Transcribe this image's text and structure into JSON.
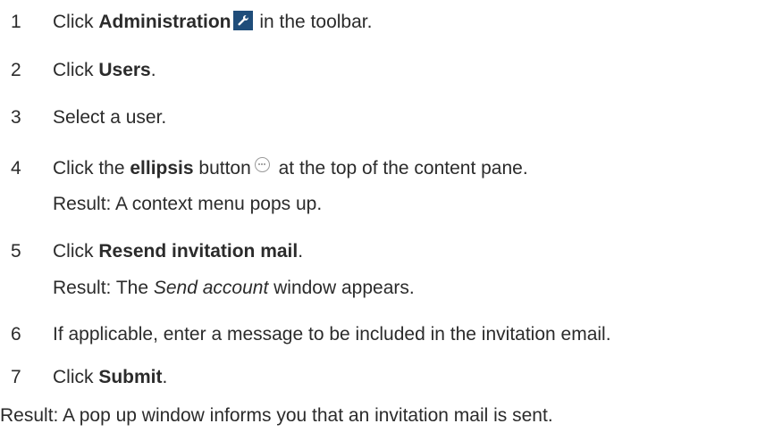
{
  "steps": [
    {
      "num": "1",
      "pre": "Click ",
      "bold": "Administration",
      "post": " in the toolbar.",
      "icon": "wrench-icon"
    },
    {
      "num": "2",
      "pre": "Click ",
      "bold": "Users",
      "post": "."
    },
    {
      "num": "3",
      "text": "Select a user."
    },
    {
      "num": "4",
      "pre": "Click the ",
      "bold": "ellipsis",
      "mid": " button",
      "post": " at the top of the content pane.",
      "icon": "ellipsis-icon",
      "result": "Result: A context menu pops up."
    },
    {
      "num": "5",
      "pre": "Click ",
      "bold": "Resend invitation mail",
      "post": ".",
      "result_pre": "Result: The ",
      "result_italic": "Send account",
      "result_post": " window appears."
    },
    {
      "num": "6",
      "text": "If applicable, enter a message to be included in the invitation email."
    },
    {
      "num": "7",
      "pre": "Click ",
      "bold": "Submit",
      "post": "."
    }
  ],
  "final_result": "Result: A pop up window informs you that an invitation mail is sent.",
  "colors": {
    "text": "#2b2b2b",
    "icon_bg": "#1f4d7a",
    "ellipsis_border": "#9a9a9a"
  }
}
